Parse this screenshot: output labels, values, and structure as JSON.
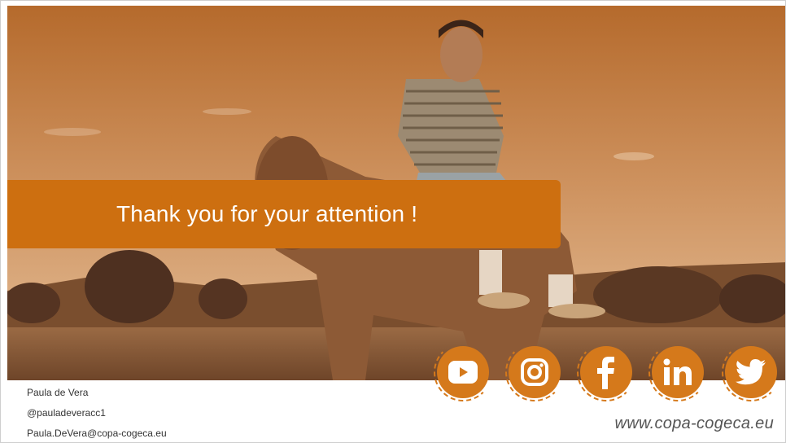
{
  "slide": {
    "title": "Thank you for your attention !",
    "contact": {
      "name": "Paula de Vera",
      "handle": "@pauladeveracc1",
      "email": "Paula.DeVera@copa-cogeca.eu"
    },
    "website": "www.copa-cogeca.eu",
    "socials": [
      {
        "name": "youtube-icon"
      },
      {
        "name": "instagram-icon"
      },
      {
        "name": "facebook-icon"
      },
      {
        "name": "linkedin-icon"
      },
      {
        "name": "twitter-icon"
      }
    ],
    "colors": {
      "banner": "#cd6f10",
      "social": "#d5791b",
      "sky": "#c98a55",
      "ground": "#8a5d3a"
    }
  }
}
